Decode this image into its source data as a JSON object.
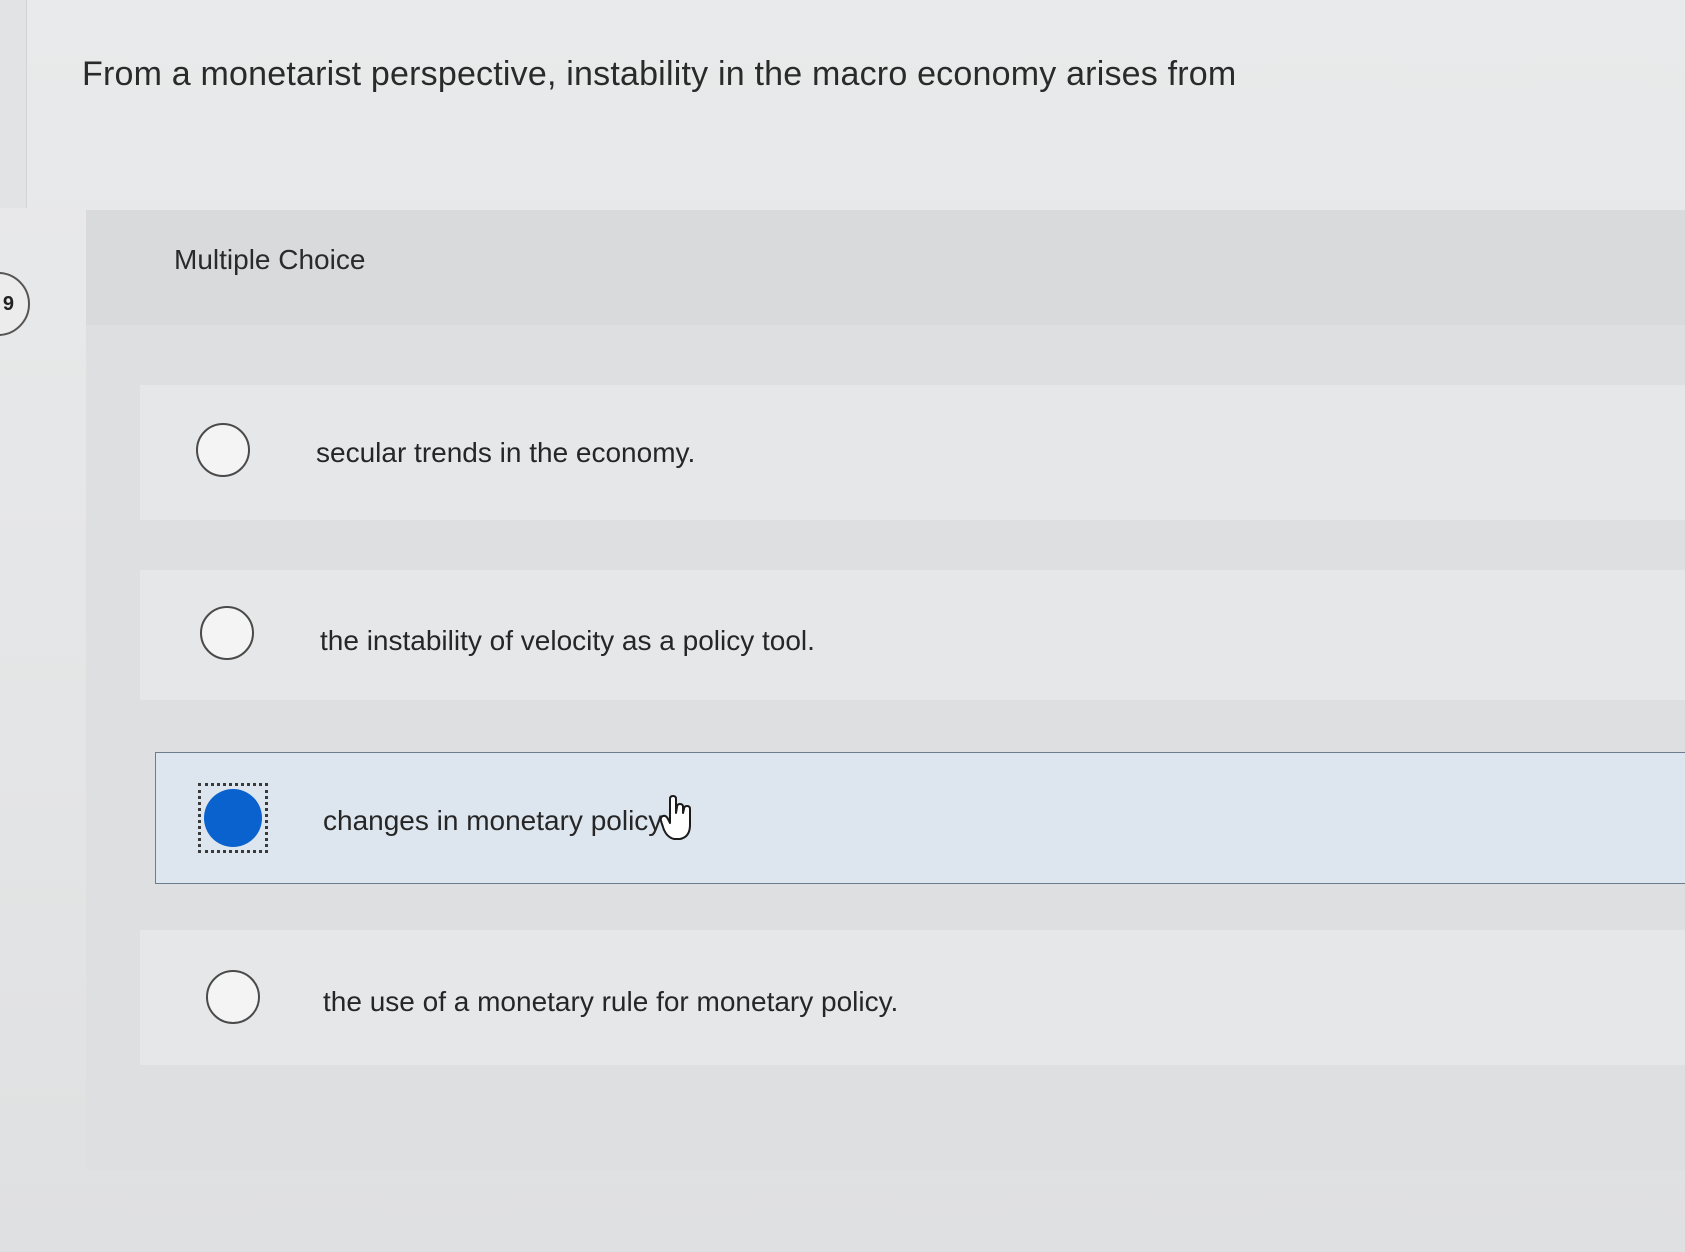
{
  "question": {
    "number": "9",
    "text": "From a monetarist perspective, instability in the macro economy arises from"
  },
  "answer_section": {
    "type_label": "Multiple Choice",
    "options": [
      {
        "label": "secular trends in the economy.",
        "selected": false
      },
      {
        "label": "the instability of velocity as a policy tool.",
        "selected": false
      },
      {
        "label": "changes in monetary policy.",
        "selected": true
      },
      {
        "label": "the use of a monetary rule for monetary policy.",
        "selected": false
      }
    ]
  },
  "colors": {
    "selected_radio": "#0a62cf",
    "selected_row_bg": "#dde5ee"
  },
  "icons": {
    "cursor": "hand-pointer-icon"
  }
}
